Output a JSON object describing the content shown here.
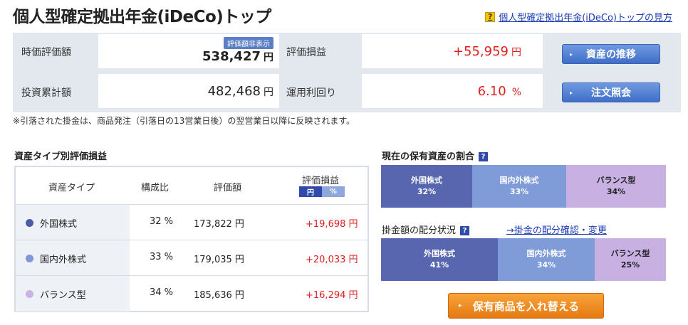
{
  "header": {
    "title": "個人型確定拠出年金(iDeCo)トップ",
    "help_icon": "?",
    "help_link": "個人型確定拠出年金(iDeCo)トップの見方"
  },
  "summary": {
    "valuation_label": "時価評価額",
    "valuation_badge": "評価額非表示",
    "valuation_value": "538,427",
    "unit": "円",
    "investment_label": "投資累計額",
    "investment_value": "482,468",
    "pl_label": "評価損益",
    "pl_value": "+55,959",
    "yield_label": "運用利回り",
    "yield_value": "6.10",
    "yield_unit": "%",
    "btn_trend": "資産の推移",
    "btn_orders": "注文照会",
    "btn_icon": "▸"
  },
  "note": "※引落された掛金は、商品発注（引落日の13営業日後）の翌営業日以降に反映されます。",
  "asset_table": {
    "title": "資産タイプ別評価損益",
    "headers": [
      "資産タイプ",
      "構成比",
      "評価額",
      "評価損益"
    ],
    "toggle": [
      "円",
      "%"
    ],
    "rows": [
      {
        "name": "外国株式",
        "ratio": "32 %",
        "amount": "173,822 円",
        "pl": "+19,698 円",
        "color": "#4d5aa6"
      },
      {
        "name": "国内外株式",
        "ratio": "33 %",
        "amount": "179,035 円",
        "pl": "+20,033 円",
        "color": "#7f97d6"
      },
      {
        "name": "バランス型",
        "ratio": "34 %",
        "amount": "185,636 円",
        "pl": "+16,294 円",
        "color": "#cab2e2"
      }
    ]
  },
  "holdings": {
    "title": "現在の保有資産の割合",
    "help_icon": "?",
    "segments": [
      {
        "label": "外国株式",
        "pct": "32%",
        "share": 32,
        "bg": "#5866b0",
        "fg": "#ffffff"
      },
      {
        "label": "国内外株式",
        "pct": "33%",
        "share": 33,
        "bg": "#7f9bd8",
        "fg": "#ffffff"
      },
      {
        "label": "バランス型",
        "pct": "34%",
        "share": 35,
        "bg": "#c9b0e2",
        "fg": "#222222"
      }
    ]
  },
  "allocation": {
    "title": "掛金額の配分状況",
    "help_icon": "?",
    "link": "→掛金の配分確認・変更",
    "segments": [
      {
        "label": "外国株式",
        "pct": "41%",
        "share": 41,
        "bg": "#5866b0",
        "fg": "#ffffff"
      },
      {
        "label": "国内外株式",
        "pct": "34%",
        "share": 34,
        "bg": "#7f9bd8",
        "fg": "#ffffff"
      },
      {
        "label": "バランス型",
        "pct": "25%",
        "share": 25,
        "bg": "#c9b0e2",
        "fg": "#222222"
      }
    ]
  },
  "swap_button": {
    "label": "保有商品を入れ替える",
    "icon": "▸"
  }
}
